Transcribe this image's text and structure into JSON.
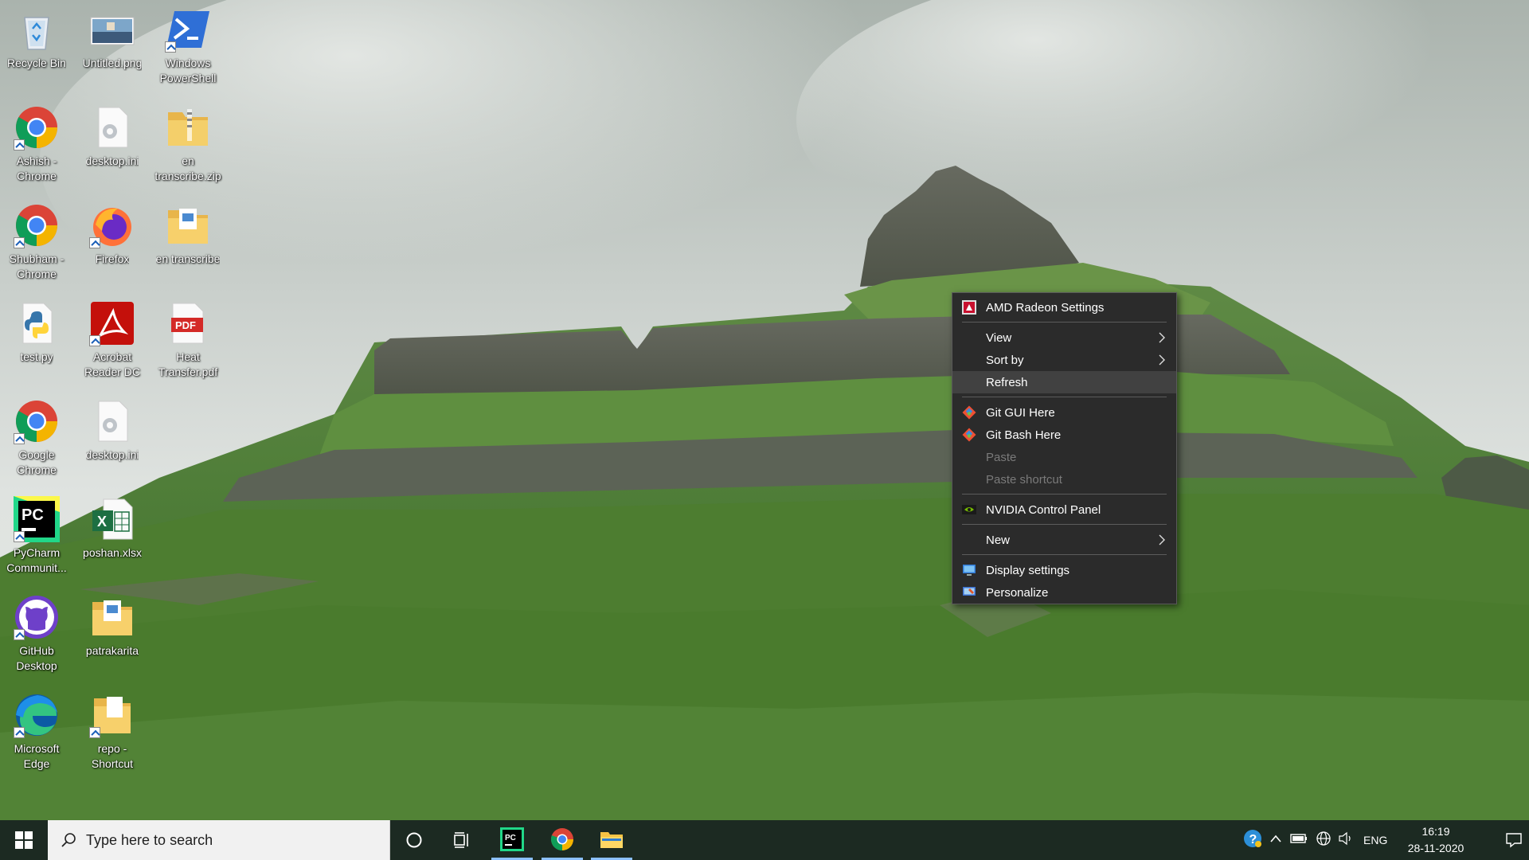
{
  "desktop": {
    "icons": [
      {
        "label": "Recycle Bin",
        "icon": "recycle-bin-icon"
      },
      {
        "label": "Untitled.png",
        "icon": "image-file-icon"
      },
      {
        "label": "Windows PowerShell",
        "icon": "powershell-icon"
      },
      {
        "label": "Ashish - Chrome",
        "icon": "chrome-icon"
      },
      {
        "label": "desktop.ini",
        "icon": "settings-file-icon"
      },
      {
        "label": "en transcribe.zip",
        "icon": "zip-folder-icon"
      },
      {
        "label": "Shubham - Chrome",
        "icon": "chrome-icon"
      },
      {
        "label": "Firefox",
        "icon": "firefox-icon"
      },
      {
        "label": "en transcribe",
        "icon": "folder-icon"
      },
      {
        "label": "test.py",
        "icon": "python-file-icon"
      },
      {
        "label": "Acrobat Reader DC",
        "icon": "acrobat-icon"
      },
      {
        "label": "Heat Transfer.pdf",
        "icon": "pdf-file-icon"
      },
      {
        "label": "Google Chrome",
        "icon": "chrome-icon"
      },
      {
        "label": "desktop.ini",
        "icon": "settings-file-icon"
      },
      {
        "label": "PyCharm Communit...",
        "icon": "pycharm-icon"
      },
      {
        "label": "poshan.xlsx",
        "icon": "excel-file-icon"
      },
      {
        "label": "GitHub Desktop",
        "icon": "github-desktop-icon"
      },
      {
        "label": "patrakarita",
        "icon": "folder-icon"
      },
      {
        "label": "Microsoft Edge",
        "icon": "edge-icon"
      },
      {
        "label": "repo - Shortcut",
        "icon": "folder-shortcut-icon"
      }
    ]
  },
  "context_menu": {
    "items": [
      {
        "label": "AMD Radeon Settings",
        "icon": "amd-radeon-icon"
      },
      {
        "label": "View",
        "submenu": true
      },
      {
        "label": "Sort by",
        "submenu": true
      },
      {
        "label": "Refresh",
        "highlighted": true
      },
      {
        "label": "Git GUI Here",
        "icon": "git-icon"
      },
      {
        "label": "Git Bash Here",
        "icon": "git-icon"
      },
      {
        "label": "Paste",
        "disabled": true
      },
      {
        "label": "Paste shortcut",
        "disabled": true
      },
      {
        "label": "NVIDIA Control Panel",
        "icon": "nvidia-icon"
      },
      {
        "label": "New",
        "submenu": true
      },
      {
        "label": "Display settings",
        "icon": "display-icon"
      },
      {
        "label": "Personalize",
        "icon": "personalize-icon"
      }
    ]
  },
  "taskbar": {
    "search_placeholder": "Type here to search",
    "language": "ENG",
    "time": "16:19",
    "date": "28-11-2020",
    "pinned": [
      "pycharm-icon",
      "chrome-icon",
      "file-explorer-icon"
    ]
  },
  "colors": {
    "menu_bg": "#2b2b2b",
    "menu_highlight": "#414141",
    "taskbar_bg": "#1c2a22"
  }
}
